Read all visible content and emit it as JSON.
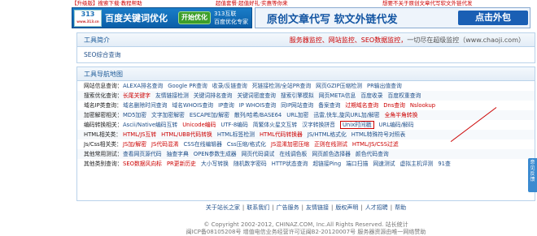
{
  "top": {
    "left_text": "【升级版】搜索下载·教程帮助",
    "mid_text": "超值套餐·超值好礼·实惠等你来",
    "right_text": "想要不关于原创文章代写软文外链代发"
  },
  "ad1": {
    "logo": "313",
    "logo_sub": "www.313.cn",
    "title": "百度关键词优化",
    "button": "开始优化",
    "side1": "313互联",
    "side2": "百度优化专家"
  },
  "ad2": {
    "title": "原创文章代写  软文外链代发",
    "button": "点击外包"
  },
  "intro": {
    "title": "工具简介",
    "announce_red": "服务器监控、网站监控、SEO数据监控，",
    "announce": "一切尽在超级监控（www.chaoji.com）",
    "body": "SEO综合查询"
  },
  "map": {
    "title": "工具导航地图",
    "rows": [
      {
        "label": "网站信息查询：",
        "items": [
          "ALEXA排名查询",
          "Google PR查询",
          "收录/反链查询",
          "死链接检测/全站PR查询",
          "网页GZIP压缩检测",
          "PR输出值查询"
        ]
      },
      {
        "label": "搜索优化查询：",
        "items": [
          "长尾关键字",
          "友情链接检测",
          "关键词排名查询",
          "关键词密度查询",
          "搜索引擎模拟",
          "网页META信息",
          "百度收录",
          "百度权重查询"
        ]
      },
      {
        "label": "域名IP类查询：",
        "items": [
          "域名删除时间查询",
          "域名WHOIS查询",
          "IP查询",
          "IP WHOIS查询",
          "同IP网站查询",
          "备案查询",
          "过期域名查询",
          "Dns查询",
          "Nslookup"
        ]
      },
      {
        "label": "加密解密相关：",
        "items": [
          "MD5加密",
          "文字加密解密",
          "ESCAPE加/解密",
          "散列/哈希/BASE64",
          "URL加密",
          "迅雷,快车,旋风URL加/解密",
          "全角半角转换"
        ]
      },
      {
        "label": "编码转换相关：",
        "items": [
          "Ascii/Native编码互转",
          "Unicode编码",
          "UTF-8编码",
          "简繁体火星文互转",
          "汉字转换拼音",
          "Unix时间戳",
          "URL编码/解码"
        ]
      },
      {
        "label": "HTML相关类：",
        "items": [
          "HTML/JS互转",
          "HTML/UBB代码转换",
          "HTML标签检测",
          "HTML代码转换器",
          "JS/HTML格式化",
          "HTML特殊符号对照表"
        ]
      },
      {
        "label": "Js/Css相关类：",
        "items": [
          "JS加/解密",
          "JS代码混淆",
          "CSS在线编辑器",
          "Css压缩/格式化",
          "JS混淆加密压缩",
          "正则在线测试",
          "HTML/JS/CSS过滤"
        ]
      },
      {
        "label": "其他常用测试：",
        "items": [
          "查看网页源代码",
          "抽查字典",
          "OPEN参数生成器",
          "网页代码调试",
          "在线调色板",
          "网页颜色选择器",
          "颜色代码查询"
        ]
      },
      {
        "label": "其他类别查询：",
        "items": [
          "SEO数据风向标",
          "PR更新历史",
          "大小写转换",
          "随机数字密码",
          "HTTP状态查询",
          "超链接Ping",
          "端口扫描",
          "网速测试",
          "虚拟主机评测",
          "91查"
        ]
      }
    ]
  },
  "footer": {
    "links": [
      "关于站长之家",
      "联系我们",
      "广告服务",
      "友情链接",
      "版权声明",
      "人才招聘",
      "帮助"
    ],
    "copyright": "© Copyright 2002-2012, CHINAZ.COM, Inc.All Rights Reserved. 站长统计",
    "icp": "闽ICP备08105208号  增值电信业务经营许可证闽B2-20120007号  服务器资源由唯一网络赞助"
  },
  "feedback": "意见反馈",
  "colors": {
    "accent": "#1f4f8a",
    "red": "#cc0000",
    "header_bg": "#e3edf7"
  }
}
